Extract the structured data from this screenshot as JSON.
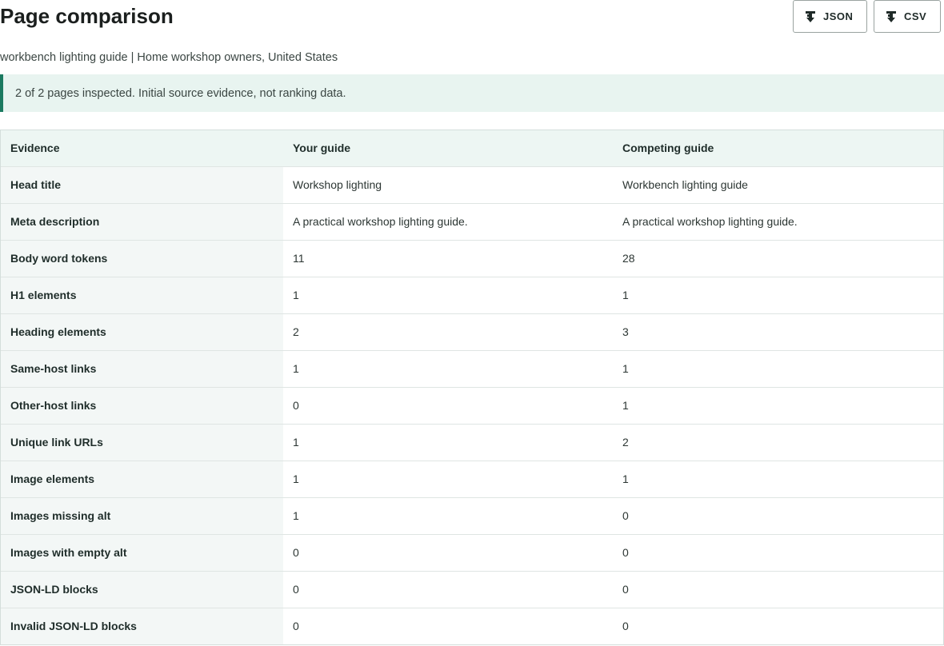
{
  "header": {
    "title": "Page comparison",
    "json_label": "JSON",
    "csv_label": "CSV"
  },
  "subtitle": "workbench lighting guide | Home workshop owners, United States",
  "notice": "2 of 2 pages inspected. Initial source evidence, not ranking data.",
  "table": {
    "columns": [
      "Evidence",
      "Your guide",
      "Competing guide"
    ],
    "rows": [
      {
        "label": "Head title",
        "a": "Workshop lighting",
        "b": "Workbench lighting guide"
      },
      {
        "label": "Meta description",
        "a": "A practical workshop lighting guide.",
        "b": "A practical workshop lighting guide."
      },
      {
        "label": "Body word tokens",
        "a": "11",
        "b": "28"
      },
      {
        "label": "H1 elements",
        "a": "1",
        "b": "1"
      },
      {
        "label": "Heading elements",
        "a": "2",
        "b": "3"
      },
      {
        "label": "Same-host links",
        "a": "1",
        "b": "1"
      },
      {
        "label": "Other-host links",
        "a": "0",
        "b": "1"
      },
      {
        "label": "Unique link URLs",
        "a": "1",
        "b": "2"
      },
      {
        "label": "Image elements",
        "a": "1",
        "b": "1"
      },
      {
        "label": "Images missing alt",
        "a": "1",
        "b": "0"
      },
      {
        "label": "Images with empty alt",
        "a": "0",
        "b": "0"
      },
      {
        "label": "JSON-LD blocks",
        "a": "0",
        "b": "0"
      },
      {
        "label": "Invalid JSON-LD blocks",
        "a": "0",
        "b": "0"
      }
    ]
  },
  "colors": {
    "accent": "#1b7a60",
    "notice_bg": "#e8f4f0",
    "header_bg": "#edf6f3"
  },
  "icons": {
    "export": "download-icon"
  }
}
